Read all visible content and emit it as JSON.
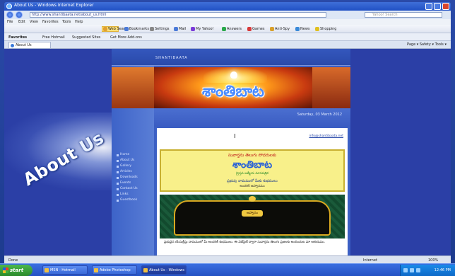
{
  "window": {
    "title": "About Us - Windows Internet Explorer"
  },
  "addressbar": {
    "url": "http://www.shantibaata.net/about_us.html",
    "search_placeholder": "Yahoo! Search"
  },
  "menubar": [
    "File",
    "Edit",
    "View",
    "Favorites",
    "Tools",
    "Help"
  ],
  "toolbar": {
    "items": [
      "Web Search",
      "Bookmarks",
      "Settings",
      "Mail",
      "My Yahoo!",
      "Answers",
      "Games",
      "Anti-Spy",
      "News",
      "Shopping"
    ]
  },
  "favorites": {
    "label": "Favorites",
    "items": [
      "Free Hotmail",
      "Suggested Sites",
      "Get More Add-ons"
    ]
  },
  "tab": {
    "label": "About Us",
    "tools": [
      "Page",
      "Safety",
      "Tools"
    ]
  },
  "overlay": {
    "word1": "About",
    "word2": "Us"
  },
  "site": {
    "name": "SHANTIBAATA",
    "banner_title": "శాంతిబాట",
    "date": "Saturday, 03 March 2012",
    "email_link": "info@shantibaata.net",
    "menu": [
      "Home",
      "About Us",
      "Gallery",
      "Articles",
      "Downloads",
      "Events",
      "Contact Us",
      "Links",
      "Guestbook"
    ],
    "infobox": {
      "line1": "సువార్తను తెలుగు సోదరులకు",
      "title": "శాంతిబాట",
      "line3": "క్రైస్తవ ఆత్మీయ మాసపత్రిక",
      "line4": "ప్రభువు నామములో మీకు శుభములు",
      "line5": "అందరికీ ఆహ్వానము"
    },
    "frame_label": "ఆహ్వానం",
    "frame_text": "ప్రభువైన యేసుక్రీస్తు నామములో మీ అందరికీ శుభములు. ఈ వెబ్‌సైట్ ద్వారా సువార్తను తెలుగు ప్రజలకు అందించుట మా ఆశయము."
  },
  "statusbar": {
    "left": "Done",
    "zone": "Internet",
    "zoom": "100%"
  },
  "taskbar": {
    "start": "start",
    "tasks": [
      "MSN - Hotmail",
      "Adobe Photoshop",
      "About Us - Windows I..."
    ],
    "clock": "12:46 PM"
  }
}
